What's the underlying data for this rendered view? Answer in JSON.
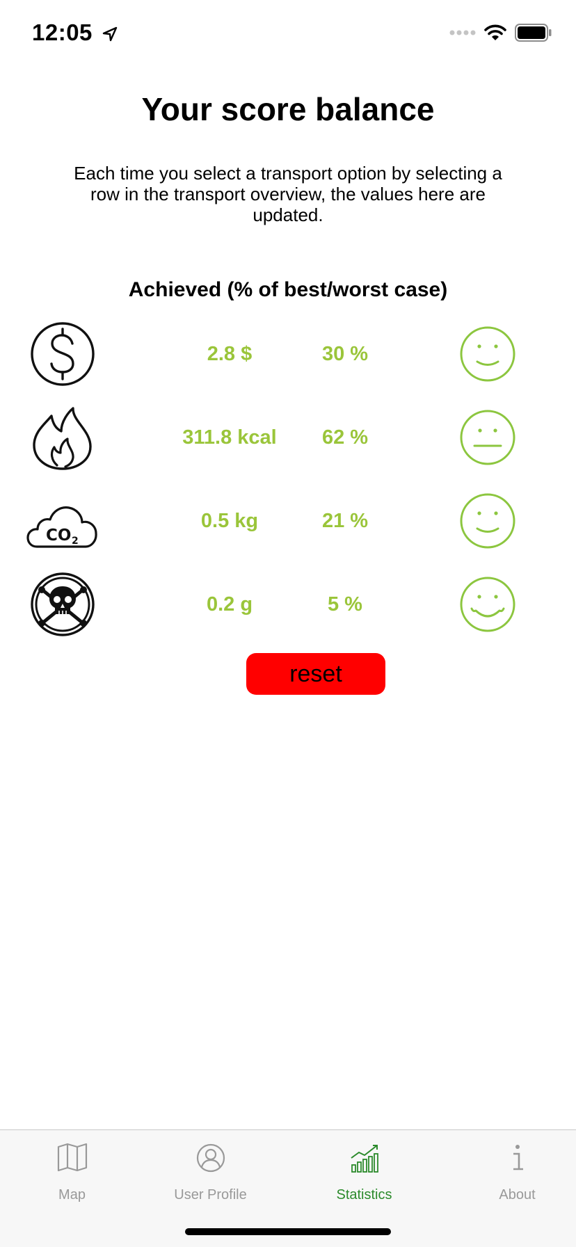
{
  "status_bar": {
    "time": "12:05"
  },
  "header": {
    "title": "Your score balance",
    "description": "Each time you select a transport option by selecting a row in the transport overview, the values here are updated."
  },
  "section_title": "Achieved (% of best/worst case)",
  "metrics": [
    {
      "icon": "dollar-icon",
      "value": "2.8 $",
      "percent": "30 %",
      "face": "smiley-happy-icon"
    },
    {
      "icon": "flame-icon",
      "value": "311.8 kcal",
      "percent": "62 %",
      "face": "smiley-neutral-icon"
    },
    {
      "icon": "co2-cloud-icon",
      "value": "0.5 kg",
      "percent": "21 %",
      "face": "smiley-happy-icon"
    },
    {
      "icon": "skull-crossbones-icon",
      "value": "0.2 g",
      "percent": "5 %",
      "face": "smiley-very-happy-icon"
    }
  ],
  "reset_label": "reset",
  "tabs": [
    {
      "label": "Map",
      "icon": "map-icon",
      "active": false
    },
    {
      "label": "User Profile",
      "icon": "user-profile-icon",
      "active": false
    },
    {
      "label": "Statistics",
      "icon": "statistics-icon",
      "active": true
    },
    {
      "label": "About",
      "icon": "info-icon",
      "active": false
    }
  ],
  "colors": {
    "value_green": "#9ac53a",
    "face_green": "#8cc63f",
    "reset_red": "#ff0000",
    "active_tab_green": "#2b8a2b",
    "inactive_tab_gray": "#999999"
  }
}
